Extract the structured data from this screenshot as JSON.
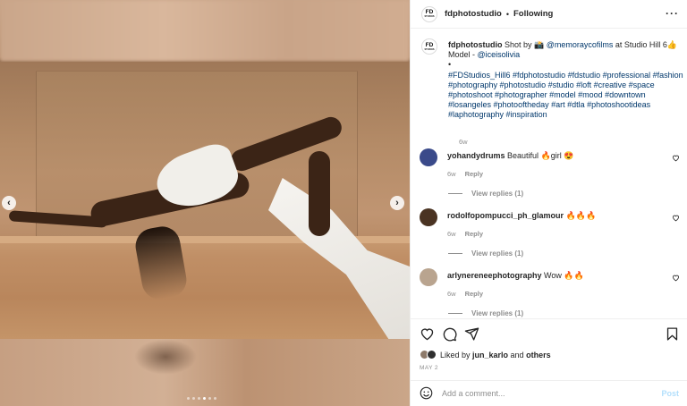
{
  "header": {
    "logo_text": "FD",
    "logo_sub": "STUDIOS",
    "username": "fdphotostudio",
    "separator": "•",
    "follow_state": "Following"
  },
  "caption": {
    "username": "fdphotostudio",
    "line1": "Shot by 📸 ",
    "mention1": "@memoraycofilms",
    "line1_rest": " at Studio Hill 6👍",
    "line2_prefix": "Model - ",
    "mention2": "@iceisolivia",
    "bullet": "•",
    "hashtags": "#FDStudios_Hill6 #fdphotostudio #fdstudio #professional #fashion #photography #photostudio #studio #loft #creative #space #photoshoot #photographer #model #mood #downtown #losangeles #photooftheday #art #dtla #photoshootideas #laphotography #inspiration",
    "age": "6w"
  },
  "comments": [
    {
      "username": "yohandydrums",
      "text": "Beautiful 🔥girl 😍",
      "age": "6w",
      "reply": "Reply",
      "view_replies": "View replies (1)",
      "avatar_color": "#3a4a8a"
    },
    {
      "username": "rodolfopompucci_ph_glamour",
      "text": "🔥🔥🔥",
      "age": "6w",
      "reply": "Reply",
      "view_replies": "View replies (1)",
      "avatar_color": "#4a3322"
    },
    {
      "username": "arlynereneephotography",
      "text": "Wow 🔥🔥",
      "age": "6w",
      "reply": "Reply",
      "view_replies": "View replies (1)",
      "avatar_color": "#b9a48f"
    }
  ],
  "likes": {
    "prefix": "Liked by ",
    "user": "jun_karlo",
    "middle": " and ",
    "others": "others"
  },
  "date": "MAY 2",
  "add_comment": {
    "placeholder": "Add a comment...",
    "post_label": "Post"
  },
  "carousel": {
    "prev": "‹",
    "next": "›",
    "slide_count": 6,
    "active_slide": 4
  }
}
